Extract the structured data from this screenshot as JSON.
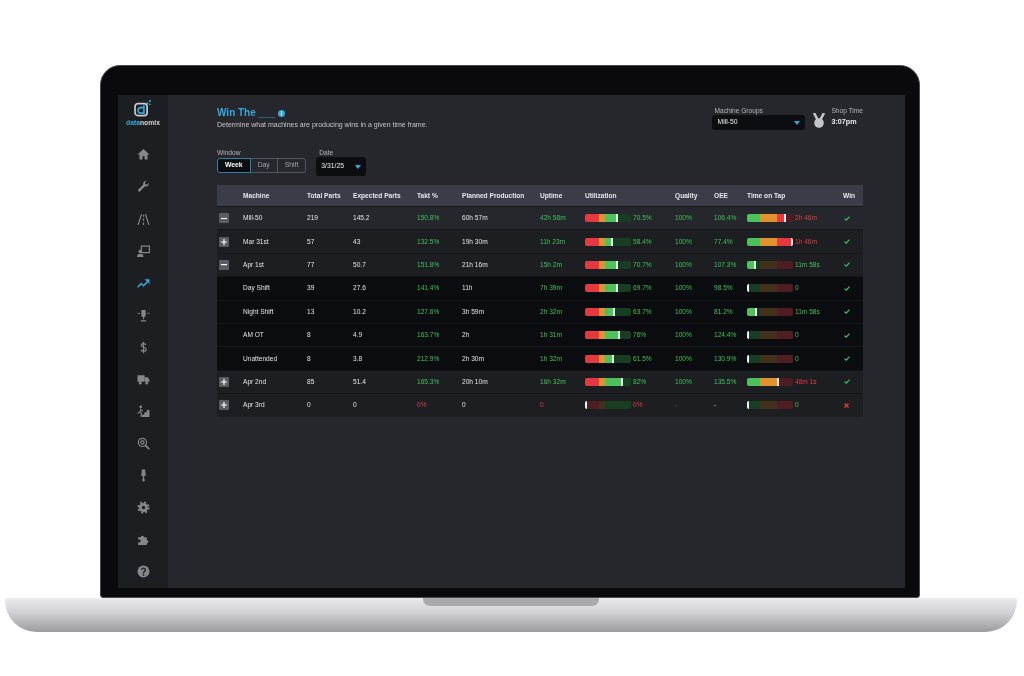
{
  "sidebar": {
    "logo": {
      "parts": [
        "data",
        "nomix"
      ]
    },
    "items": [
      {
        "kind": "home",
        "selected": false
      },
      {
        "kind": "wrench",
        "selected": false
      },
      {
        "kind": "road",
        "selected": false
      },
      {
        "kind": "presenter",
        "selected": false
      },
      {
        "kind": "trend",
        "selected": true
      },
      {
        "kind": "trophy",
        "selected": false
      },
      {
        "kind": "dollar",
        "selected": false
      },
      {
        "kind": "truck",
        "selected": false
      },
      {
        "kind": "stairs",
        "selected": false
      },
      {
        "kind": "target-search",
        "selected": false
      },
      {
        "kind": "tap",
        "selected": false
      },
      {
        "kind": "gear",
        "selected": false
      },
      {
        "kind": "puzzle",
        "selected": false
      },
      {
        "kind": "help",
        "selected": false
      }
    ]
  },
  "header": {
    "title": "Win The ___",
    "subtitle": "Determine what machines are producing wins in a given time frame."
  },
  "machine_groups": {
    "label": "Machine Groups",
    "value": "Mill-50"
  },
  "shop_time": {
    "label": "Shop Time",
    "value": "3:07pm"
  },
  "window": {
    "label": "Window",
    "options": [
      {
        "label": "Week",
        "selected": true
      },
      {
        "label": "Day",
        "selected": false
      },
      {
        "label": "Shift",
        "selected": false
      }
    ]
  },
  "date": {
    "label": "Date",
    "value": "3/31/25"
  },
  "table": {
    "columns": [
      "Machine",
      "Total Parts",
      "Expected Parts",
      "Takt %",
      "Planned Production",
      "Uptime",
      "Utilization",
      "Quality",
      "OEE",
      "Time on Tap",
      "Win"
    ],
    "rows": [
      {
        "machine": "Mill-50",
        "expanded": true,
        "total_parts": "219",
        "expected_parts": "145.2",
        "takt": {
          "text": "150.8%",
          "alert": false
        },
        "planned_production": "60h 57m",
        "uptime": {
          "text": "42h 58m",
          "alert": false
        },
        "utilization": {
          "level": 0.705,
          "reading": "70.5%",
          "alert": false
        },
        "quality": {
          "text": "100%",
          "alert": false
        },
        "oee": {
          "text": "106.4%",
          "alert": false
        },
        "time_on_tap": {
          "level": 0.83,
          "reading": "2h 46m",
          "alert": true
        },
        "win": true,
        "children": [
          {
            "machine": "Mar 31st",
            "expanded": false,
            "total_parts": "57",
            "expected_parts": "43",
            "takt": {
              "text": "132.5%",
              "alert": false
            },
            "planned_production": "19h 30m",
            "uptime": {
              "text": "11h 23m",
              "alert": false
            },
            "utilization": {
              "level": 0.584,
              "reading": "58.4%",
              "alert": false
            },
            "quality": {
              "text": "100%",
              "alert": false
            },
            "oee": {
              "text": "77.4%",
              "alert": false
            },
            "time_on_tap": {
              "level": 1.0,
              "reading": "1h 46m",
              "alert": true
            },
            "win": true
          },
          {
            "machine": "Apr 1st",
            "expanded": true,
            "total_parts": "77",
            "expected_parts": "50.7",
            "takt": {
              "text": "151.8%",
              "alert": false
            },
            "planned_production": "21h 16m",
            "uptime": {
              "text": "15h 2m",
              "alert": false
            },
            "utilization": {
              "level": 0.707,
              "reading": "70.7%",
              "alert": false
            },
            "quality": {
              "text": "100%",
              "alert": false
            },
            "oee": {
              "text": "107.3%",
              "alert": false
            },
            "time_on_tap": {
              "level": 0.17,
              "reading": "11m 58s",
              "alert": false
            },
            "win": true,
            "children": [
              {
                "machine": "Day Shift",
                "total_parts": "39",
                "expected_parts": "27.6",
                "takt": {
                  "text": "141.4%",
                  "alert": false
                },
                "planned_production": "11h",
                "uptime": {
                  "text": "7h 39m",
                  "alert": false
                },
                "utilization": {
                  "level": 0.697,
                  "reading": "69.7%",
                  "alert": false
                },
                "quality": {
                  "text": "100%",
                  "alert": false
                },
                "oee": {
                  "text": "98.5%",
                  "alert": false
                },
                "time_on_tap": {
                  "level": 0,
                  "reading": "0",
                  "alert": false
                },
                "win": true
              },
              {
                "machine": "Night Shift",
                "total_parts": "13",
                "expected_parts": "10.2",
                "takt": {
                  "text": "127.6%",
                  "alert": false
                },
                "planned_production": "3h 59m",
                "uptime": {
                  "text": "2h 32m",
                  "alert": false
                },
                "utilization": {
                  "level": 0.637,
                  "reading": "63.7%",
                  "alert": false
                },
                "quality": {
                  "text": "100%",
                  "alert": false
                },
                "oee": {
                  "text": "81.2%",
                  "alert": false
                },
                "time_on_tap": {
                  "level": 0.19,
                  "reading": "11m 58s",
                  "alert": false
                },
                "win": true
              },
              {
                "machine": "AM OT",
                "total_parts": "8",
                "expected_parts": "4.9",
                "takt": {
                  "text": "163.7%",
                  "alert": false
                },
                "planned_production": "2h",
                "uptime": {
                  "text": "1h 31m",
                  "alert": false
                },
                "utilization": {
                  "level": 0.76,
                  "reading": "76%",
                  "alert": false
                },
                "quality": {
                  "text": "100%",
                  "alert": false
                },
                "oee": {
                  "text": "124.4%",
                  "alert": false
                },
                "time_on_tap": {
                  "level": 0,
                  "reading": "0",
                  "alert": false
                },
                "win": true
              },
              {
                "machine": "Unattended",
                "total_parts": "8",
                "expected_parts": "3.8",
                "takt": {
                  "text": "212.9%",
                  "alert": false
                },
                "planned_production": "2h 30m",
                "uptime": {
                  "text": "1h 32m",
                  "alert": false
                },
                "utilization": {
                  "level": 0.615,
                  "reading": "61.5%",
                  "alert": false
                },
                "quality": {
                  "text": "100%",
                  "alert": false
                },
                "oee": {
                  "text": "130.9%",
                  "alert": false
                },
                "time_on_tap": {
                  "level": 0,
                  "reading": "0",
                  "alert": false
                },
                "win": true
              }
            ]
          },
          {
            "machine": "Apr 2nd",
            "expanded": false,
            "total_parts": "85",
            "expected_parts": "51.4",
            "takt": {
              "text": "165.3%",
              "alert": false
            },
            "planned_production": "20h 10m",
            "uptime": {
              "text": "16h 32m",
              "alert": false
            },
            "utilization": {
              "level": 0.82,
              "reading": "82%",
              "alert": false
            },
            "quality": {
              "text": "100%",
              "alert": false
            },
            "oee": {
              "text": "135.5%",
              "alert": false
            },
            "time_on_tap": {
              "level": 0.69,
              "reading": "48m 1s",
              "alert": true
            },
            "win": true
          },
          {
            "machine": "Apr 3rd",
            "expanded": false,
            "total_parts": "0",
            "expected_parts": "0",
            "takt": {
              "text": "0%",
              "alert": true
            },
            "planned_production": "0",
            "uptime": {
              "text": "0",
              "alert": true
            },
            "utilization": {
              "level": 0,
              "reading": "0%",
              "alert": true
            },
            "quality": {
              "text": "-",
              "alert": true
            },
            "oee": {
              "text": "-"
            },
            "time_on_tap": {
              "level": 0,
              "reading": "0",
              "alert": false
            },
            "win": false
          }
        ]
      }
    ]
  }
}
